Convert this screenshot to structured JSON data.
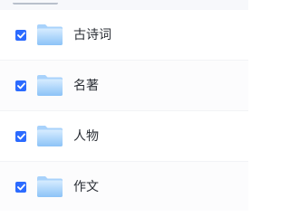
{
  "colors": {
    "accent": "#2c6bff",
    "folder_light": "#cfe8ff",
    "folder_dark": "#7db8f5",
    "text": "#2b2f36"
  },
  "items": [
    {
      "label": "古诗词",
      "checked": true,
      "icon": "folder-icon"
    },
    {
      "label": "名著",
      "checked": true,
      "icon": "folder-icon"
    },
    {
      "label": "人物",
      "checked": true,
      "icon": "folder-icon"
    },
    {
      "label": "作文",
      "checked": true,
      "icon": "folder-icon"
    }
  ]
}
